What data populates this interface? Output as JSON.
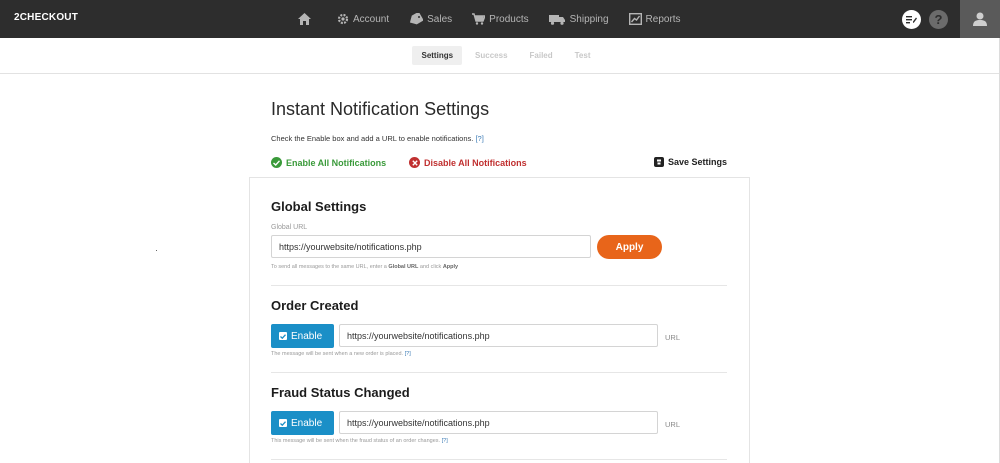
{
  "app": {
    "logo": "2CHECKOUT"
  },
  "nav": {
    "items": [
      {
        "label": "Account",
        "icon": "gear-icon"
      },
      {
        "label": "Sales",
        "icon": "tag-icon"
      },
      {
        "label": "Products",
        "icon": "cart-icon"
      },
      {
        "label": "Shipping",
        "icon": "truck-icon"
      },
      {
        "label": "Reports",
        "icon": "chart-icon"
      }
    ],
    "help": "?"
  },
  "subnav": {
    "tabs": [
      "Settings",
      "Success",
      "Failed",
      "Test"
    ],
    "active": "Settings"
  },
  "page": {
    "title": "Instant Notification Settings",
    "intro": "Check the Enable box and add a URL to enable notifications.",
    "help_link": "[?]",
    "enable_all": "Enable All Notifications",
    "disable_all": "Disable All Notifications",
    "save": "Save Settings"
  },
  "global": {
    "title": "Global Settings",
    "label": "Global URL",
    "url": "https://yourwebsite/notifications.php",
    "apply": "Apply",
    "hint_pre": "To send all messages to the same URL, enter a ",
    "hint_b1": "Global URL",
    "hint_mid": " and click ",
    "hint_b2": "Apply"
  },
  "sections": [
    {
      "title": "Order Created",
      "enable": "Enable",
      "url": "https://yourwebsite/notifications.php",
      "suffix": "URL",
      "hint": "The message will be sent when a new order is placed.",
      "help": "[?]"
    },
    {
      "title": "Fraud Status Changed",
      "enable": "Enable",
      "url": "https://yourwebsite/notifications.php",
      "suffix": "URL",
      "hint": "This message will be sent when the fraud status of an order changes.",
      "help": "[?]"
    }
  ],
  "colors": {
    "topbar": "#2d2d2d",
    "apply": "#e8651a",
    "enable": "#1a8fc7",
    "green": "#3a9a3a",
    "red": "#c03030"
  }
}
